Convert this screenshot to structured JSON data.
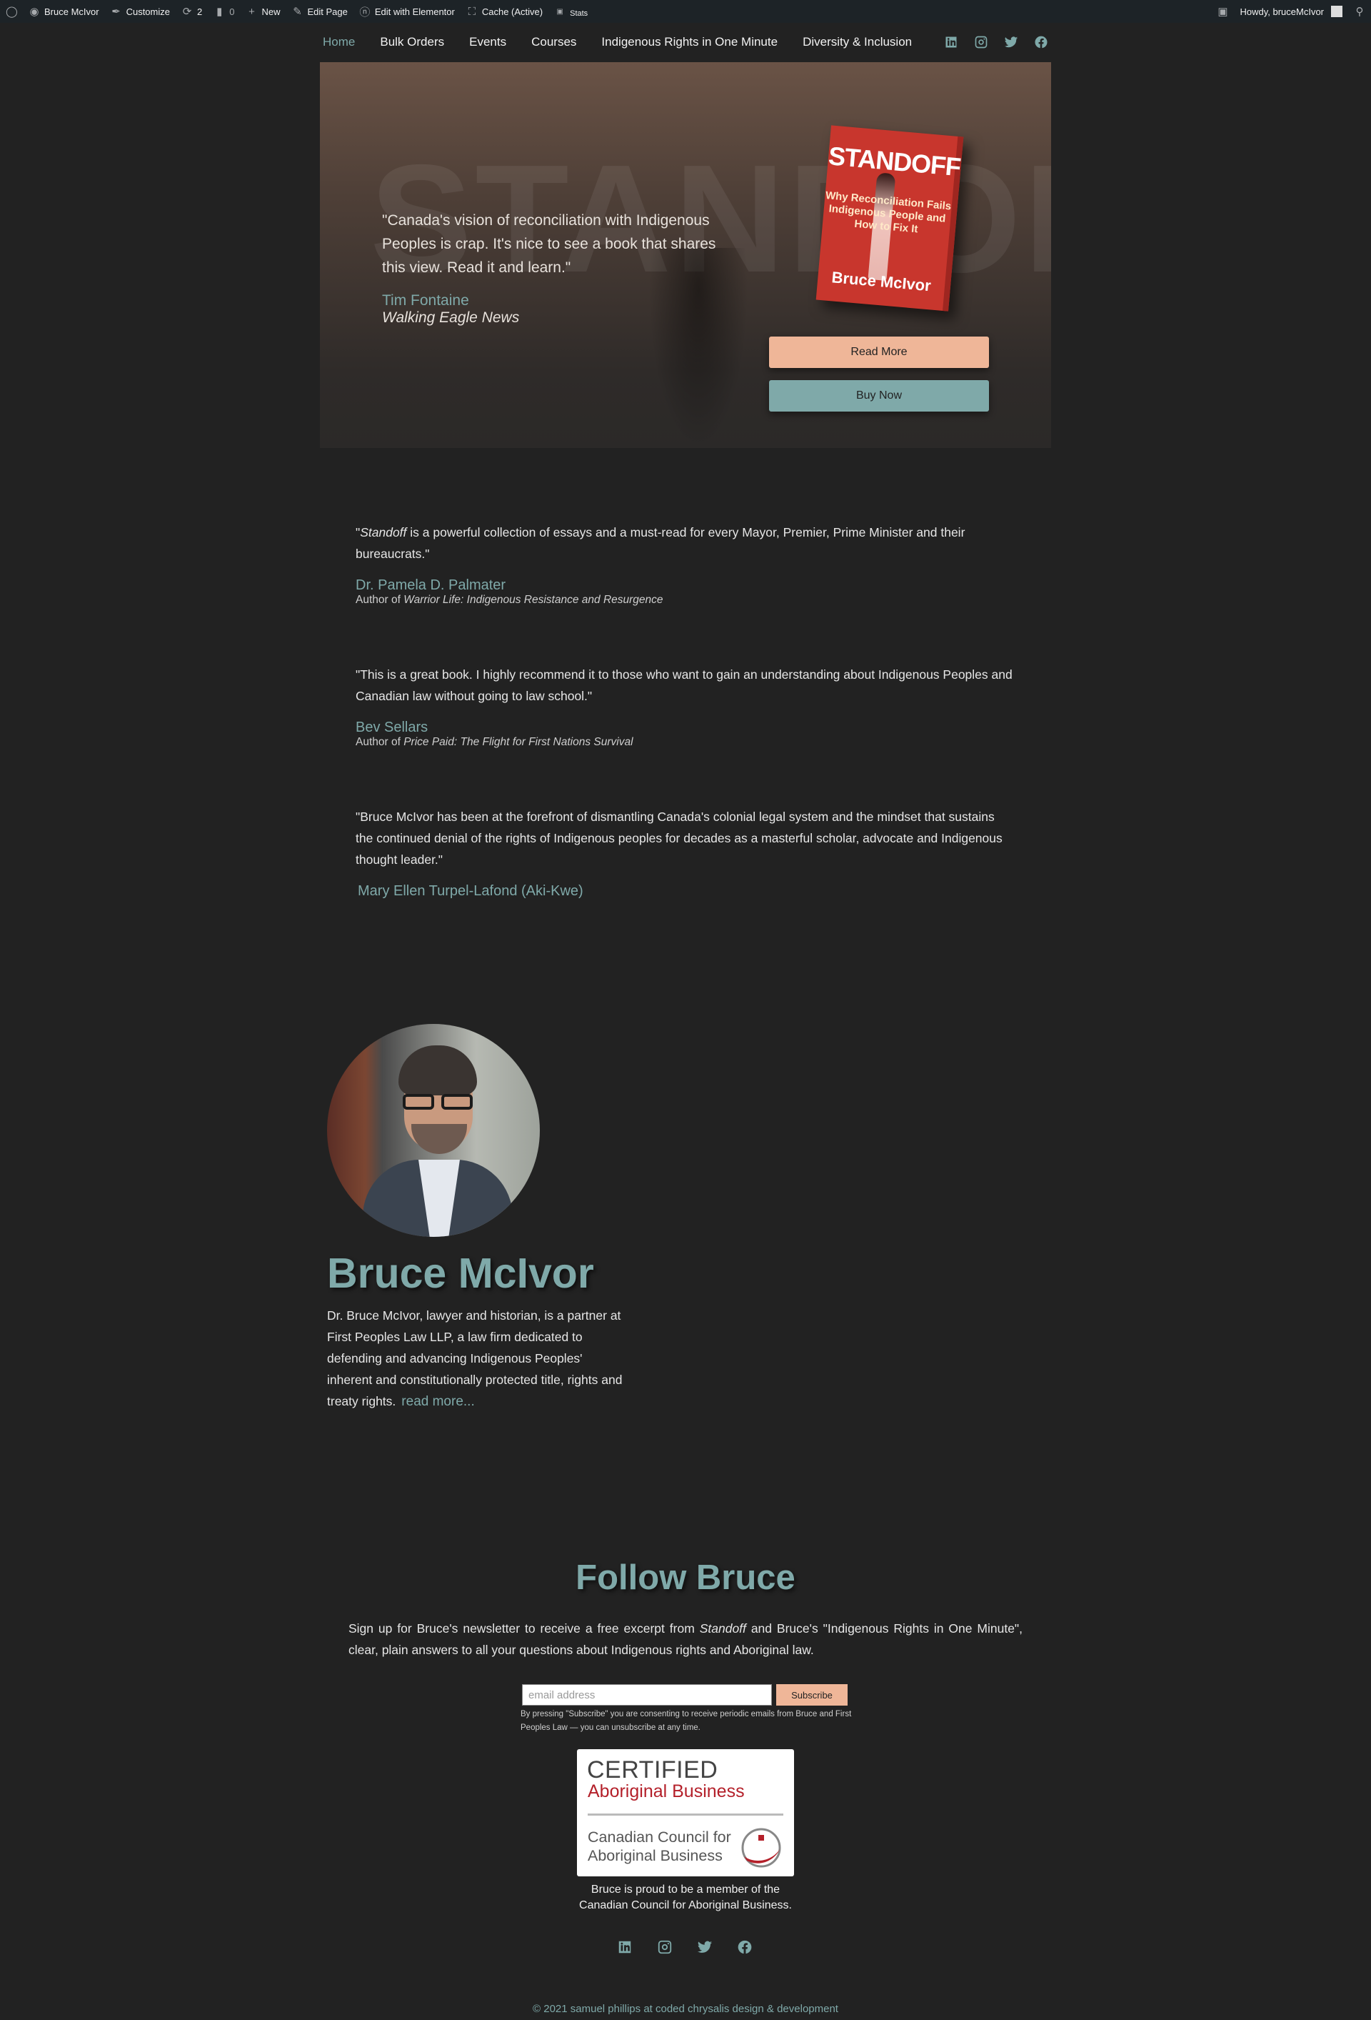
{
  "adminbar": {
    "site_name": "Bruce McIvor",
    "customize": "Customize",
    "updates_count": "2",
    "comments_count": "0",
    "new": "New",
    "edit_page": "Edit Page",
    "edit_elementor": "Edit with Elementor",
    "cache": "Cache (Active)",
    "stats": "Stats",
    "howdy": "Howdy, bruceMcIvor"
  },
  "nav": {
    "items": [
      "Home",
      "Bulk Orders",
      "Events",
      "Courses",
      "Indigenous Rights in One Minute",
      "Diversity & Inclusion"
    ],
    "social": [
      "linkedin-icon",
      "instagram-icon",
      "twitter-icon",
      "facebook-icon"
    ]
  },
  "hero": {
    "background_word": "STANDOFF",
    "quote": "\"Canada's vision of reconciliation with Indigenous Peoples is crap. It's nice to see a book that shares this view. Read it and learn.\"",
    "author": "Tim Fontaine",
    "publication": "Walking Eagle News",
    "book": {
      "title": "STANDOFF",
      "subtitle": "Why Reconciliation Fails Indigenous People and How to Fix It",
      "author": "Bruce McIvor"
    },
    "read_more": "Read More",
    "buy_now": "Buy Now"
  },
  "testimonials": [
    {
      "book": "Standoff",
      "quote_rest": " is a powerful collection of essays and a must-read for every Mayor, Premier, Prime Minister and their bureaucrats.\"",
      "author": "Dr. Pamela D. Palmater",
      "aff_prefix": "Author of ",
      "aff_title": "Warrior Life: Indigenous Resistance and Resurgence"
    },
    {
      "quote": "\"This is a great book. I highly recommend it to those who want to gain an understanding about Indigenous Peoples and Canadian law without going to law school.\"",
      "author": "Bev Sellars",
      "aff_prefix": "Author of ",
      "aff_title": "Price Paid: The Flight for First Nations Survival"
    },
    {
      "quote": "\"Bruce McIvor has been at the forefront of dismantling Canada's colonial legal system and the mindset that sustains the continued denial of the rights of Indigenous peoples for decades as a masterful scholar, advocate and Indigenous thought leader.\"",
      "author": "Mary Ellen Turpel-Lafond (Aki-Kwe)"
    }
  ],
  "bio": {
    "name": "Bruce McIvor",
    "text": "Dr. Bruce McIvor, lawyer and historian, is a partner at First Peoples Law LLP, a law firm dedicated to defending and advancing Indigenous Peoples' inherent and constitutionally protected title, rights and treaty rights.",
    "read_more": "read more..."
  },
  "follow": {
    "title": "Follow Bruce",
    "text_before": "Sign up for Bruce's newsletter to receive a free excerpt from ",
    "text_book": "Standoff",
    "text_after": " and Bruce's \"Indigenous Rights in One Minute\", clear, plain answers to all your questions about Indigenous rights and Aboriginal law.",
    "email_placeholder": "email address",
    "subscribe": "Subscribe",
    "consent": "By pressing \"Subscribe\" you are consenting to receive periodic emails from Bruce and First Peoples Law — you can unsubscribe at any time.",
    "badge": {
      "line1": "CERTIFIED",
      "line2": "Aboriginal Business",
      "line3": "Canadian Council for",
      "line4": "Aboriginal Business"
    },
    "badge_caption_1": "Bruce is proud to be a member of the",
    "badge_caption_2": "Canadian Council for Aboriginal Business."
  },
  "footer": {
    "copyright": "© 2021 samuel phillips at coded chrysalis design & development"
  },
  "colors": {
    "accent_teal": "#7fa9a9",
    "accent_peach": "#efb698",
    "background": "#222222",
    "adminbar": "#1d2327"
  }
}
